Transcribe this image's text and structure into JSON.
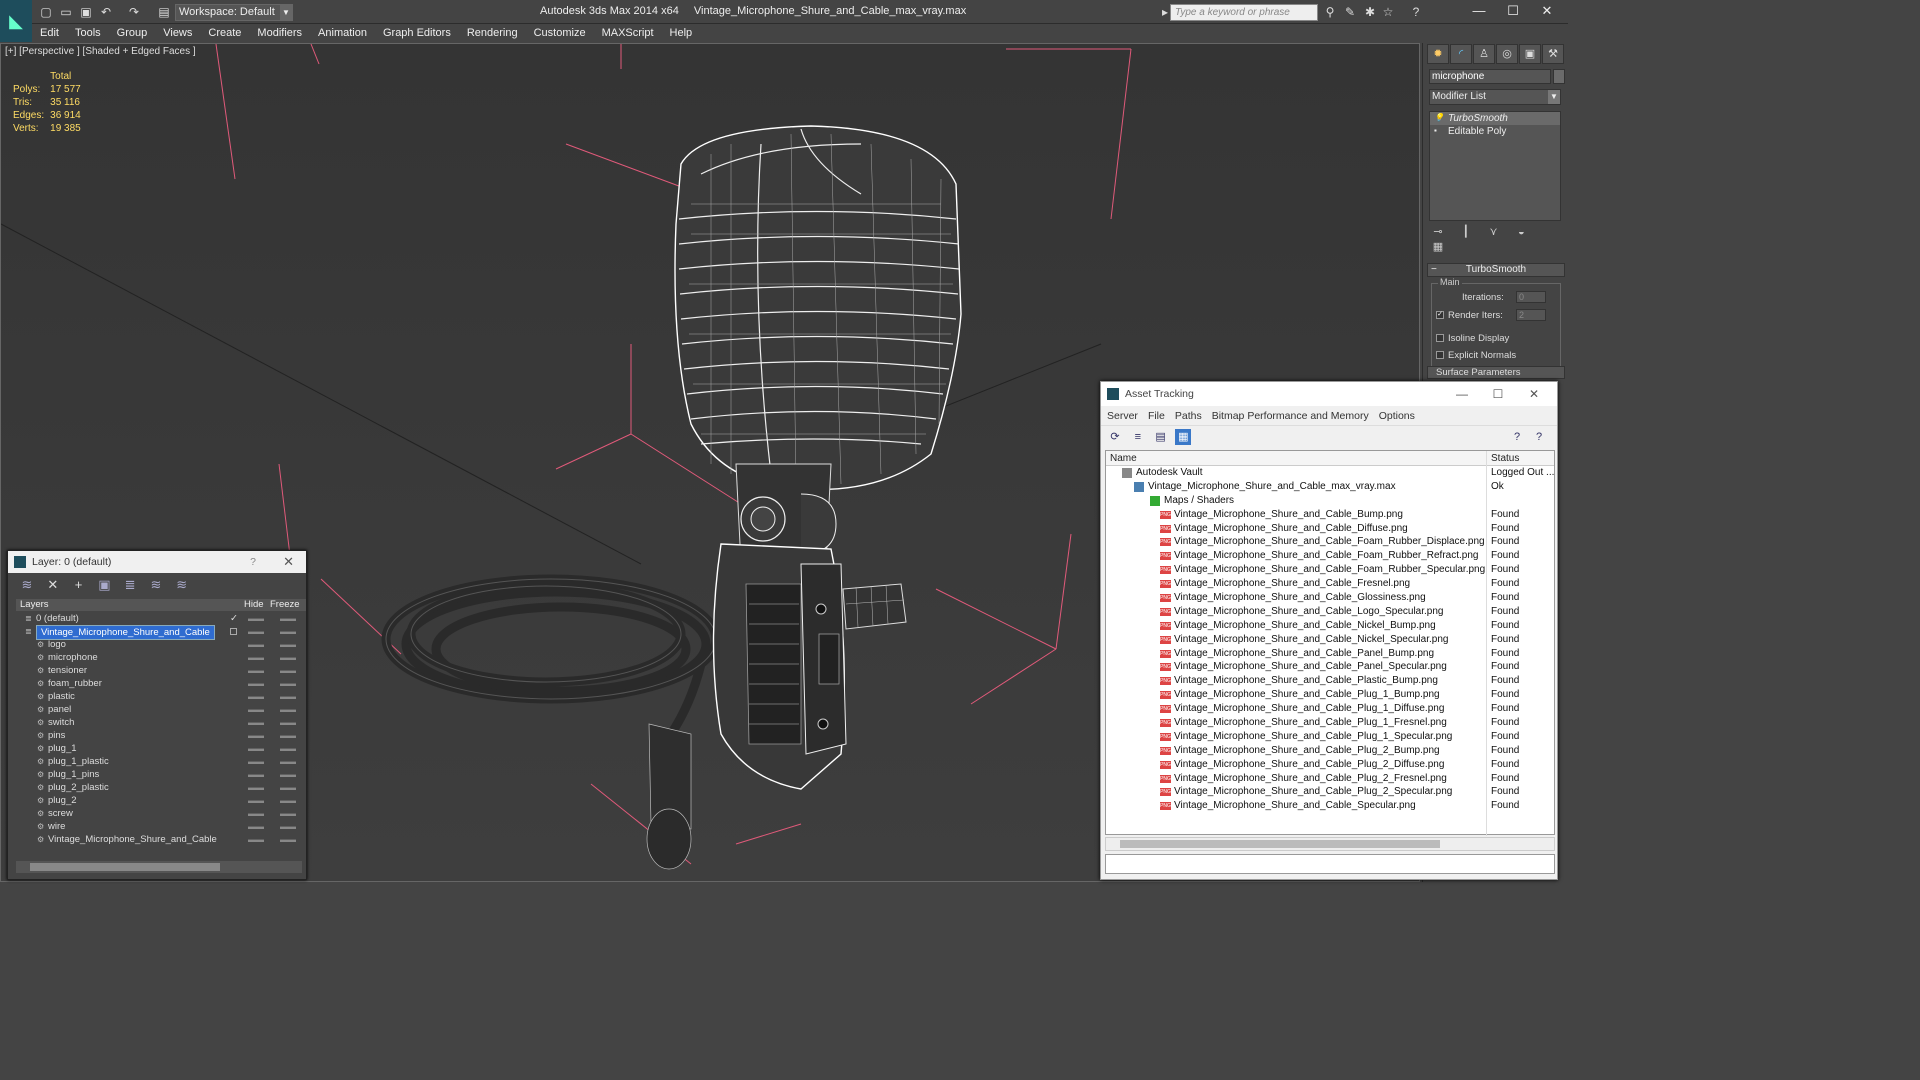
{
  "titlebar": {
    "workspace": "Workspace: Default",
    "app_name": "Autodesk 3ds Max  2014 x64",
    "file_name": "Vintage_Microphone_Shure_and_Cable_max_vray.max",
    "search_placeholder": "Type a keyword or phrase"
  },
  "menu": [
    "Edit",
    "Tools",
    "Group",
    "Views",
    "Create",
    "Modifiers",
    "Animation",
    "Graph Editors",
    "Rendering",
    "Customize",
    "MAXScript",
    "Help"
  ],
  "viewport": {
    "label": "[+] [Perspective ] [Shaded + Edged Faces ]",
    "stats": {
      "header": "Total",
      "rows": [
        {
          "label": "Polys:",
          "value": "17 577"
        },
        {
          "label": "Tris:",
          "value": "35 116"
        },
        {
          "label": "Edges:",
          "value": "36 914"
        },
        {
          "label": "Verts:",
          "value": "19 385"
        }
      ]
    }
  },
  "command_panel": {
    "object_name": "microphone",
    "modifier_list": "Modifier List",
    "stack": [
      "TurboSmooth",
      "Editable Poly"
    ],
    "rollout": {
      "title": "TurboSmooth",
      "group": "Main",
      "iterations_label": "Iterations:",
      "iterations_value": "0",
      "render_iters_label": "Render Iters:",
      "render_iters_value": "2",
      "isoline_label": "Isoline Display",
      "explicit_label": "Explicit Normals",
      "surface_label": "Surface Parameters"
    }
  },
  "layer_window": {
    "title": "Layer: 0 (default)",
    "help": "?",
    "columns": {
      "layers": "Layers",
      "hide": "Hide",
      "freeze": "Freeze"
    },
    "rows": [
      {
        "name": "0 (default)",
        "level": 0
      },
      {
        "name": "Vintage_Microphone_Shure_and_Cable",
        "level": 0,
        "selected": true
      },
      {
        "name": "logo",
        "level": 1
      },
      {
        "name": "microphone",
        "level": 1
      },
      {
        "name": "tensioner",
        "level": 1
      },
      {
        "name": "foam_rubber",
        "level": 1
      },
      {
        "name": "plastic",
        "level": 1
      },
      {
        "name": "panel",
        "level": 1
      },
      {
        "name": "switch",
        "level": 1
      },
      {
        "name": "pins",
        "level": 1
      },
      {
        "name": "plug_1",
        "level": 1
      },
      {
        "name": "plug_1_plastic",
        "level": 1
      },
      {
        "name": "plug_1_pins",
        "level": 1
      },
      {
        "name": "plug_2_plastic",
        "level": 1
      },
      {
        "name": "plug_2",
        "level": 1
      },
      {
        "name": "screw",
        "level": 1
      },
      {
        "name": "wire",
        "level": 1
      },
      {
        "name": "Vintage_Microphone_Shure_and_Cable",
        "level": 1
      }
    ]
  },
  "asset_window": {
    "title": "Asset Tracking",
    "menu": [
      "Server",
      "File",
      "Paths",
      "Bitmap Performance and Memory",
      "Options"
    ],
    "columns": {
      "name": "Name",
      "status": "Status"
    },
    "rows": [
      {
        "name": "Autodesk Vault",
        "status": "Logged Out ...",
        "kind": "vault",
        "level": 0
      },
      {
        "name": "Vintage_Microphone_Shure_and_Cable_max_vray.max",
        "status": "Ok",
        "kind": "file",
        "level": 1
      },
      {
        "name": "Maps / Shaders",
        "status": "",
        "kind": "maps",
        "level": 2
      },
      {
        "name": "Vintage_Microphone_Shure_and_Cable_Bump.png",
        "status": "Found",
        "kind": "png",
        "level": 3
      },
      {
        "name": "Vintage_Microphone_Shure_and_Cable_Diffuse.png",
        "status": "Found",
        "kind": "png",
        "level": 3
      },
      {
        "name": "Vintage_Microphone_Shure_and_Cable_Foam_Rubber_Displace.png",
        "status": "Found",
        "kind": "png",
        "level": 3
      },
      {
        "name": "Vintage_Microphone_Shure_and_Cable_Foam_Rubber_Refract.png",
        "status": "Found",
        "kind": "png",
        "level": 3
      },
      {
        "name": "Vintage_Microphone_Shure_and_Cable_Foam_Rubber_Specular.png",
        "status": "Found",
        "kind": "png",
        "level": 3
      },
      {
        "name": "Vintage_Microphone_Shure_and_Cable_Fresnel.png",
        "status": "Found",
        "kind": "png",
        "level": 3
      },
      {
        "name": "Vintage_Microphone_Shure_and_Cable_Glossiness.png",
        "status": "Found",
        "kind": "png",
        "level": 3
      },
      {
        "name": "Vintage_Microphone_Shure_and_Cable_Logo_Specular.png",
        "status": "Found",
        "kind": "png",
        "level": 3
      },
      {
        "name": "Vintage_Microphone_Shure_and_Cable_Nickel_Bump.png",
        "status": "Found",
        "kind": "png",
        "level": 3
      },
      {
        "name": "Vintage_Microphone_Shure_and_Cable_Nickel_Specular.png",
        "status": "Found",
        "kind": "png",
        "level": 3
      },
      {
        "name": "Vintage_Microphone_Shure_and_Cable_Panel_Bump.png",
        "status": "Found",
        "kind": "png",
        "level": 3
      },
      {
        "name": "Vintage_Microphone_Shure_and_Cable_Panel_Specular.png",
        "status": "Found",
        "kind": "png",
        "level": 3
      },
      {
        "name": "Vintage_Microphone_Shure_and_Cable_Plastic_Bump.png",
        "status": "Found",
        "kind": "png",
        "level": 3
      },
      {
        "name": "Vintage_Microphone_Shure_and_Cable_Plug_1_Bump.png",
        "status": "Found",
        "kind": "png",
        "level": 3
      },
      {
        "name": "Vintage_Microphone_Shure_and_Cable_Plug_1_Diffuse.png",
        "status": "Found",
        "kind": "png",
        "level": 3
      },
      {
        "name": "Vintage_Microphone_Shure_and_Cable_Plug_1_Fresnel.png",
        "status": "Found",
        "kind": "png",
        "level": 3
      },
      {
        "name": "Vintage_Microphone_Shure_and_Cable_Plug_1_Specular.png",
        "status": "Found",
        "kind": "png",
        "level": 3
      },
      {
        "name": "Vintage_Microphone_Shure_and_Cable_Plug_2_Bump.png",
        "status": "Found",
        "kind": "png",
        "level": 3
      },
      {
        "name": "Vintage_Microphone_Shure_and_Cable_Plug_2_Diffuse.png",
        "status": "Found",
        "kind": "png",
        "level": 3
      },
      {
        "name": "Vintage_Microphone_Shure_and_Cable_Plug_2_Fresnel.png",
        "status": "Found",
        "kind": "png",
        "level": 3
      },
      {
        "name": "Vintage_Microphone_Shure_and_Cable_Plug_2_Specular.png",
        "status": "Found",
        "kind": "png",
        "level": 3
      },
      {
        "name": "Vintage_Microphone_Shure_and_Cable_Specular.png",
        "status": "Found",
        "kind": "png",
        "level": 3
      }
    ]
  },
  "colors": {
    "accent": "#2f6cd0",
    "stats": "#ffdc64",
    "grid": "#e05a7a",
    "wire": "#ffffff"
  }
}
